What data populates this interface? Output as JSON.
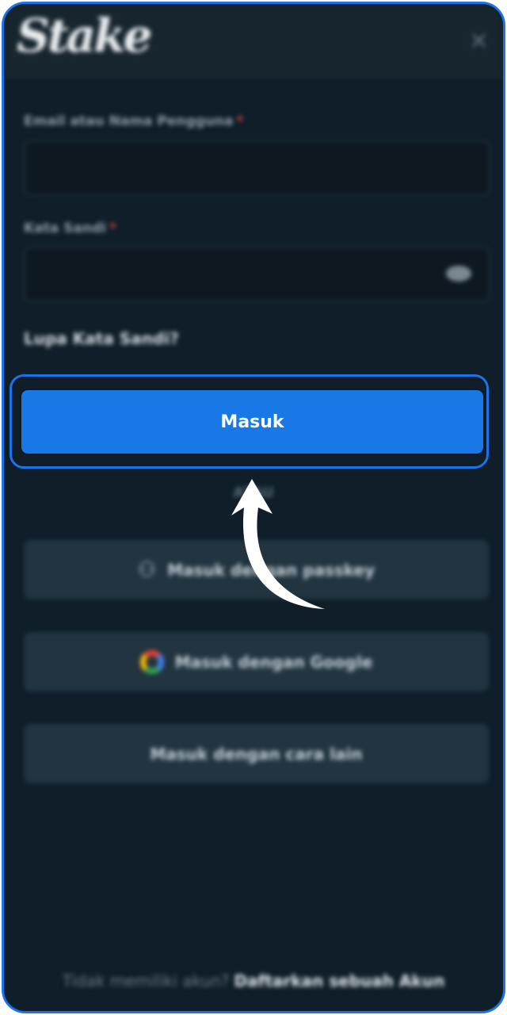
{
  "header": {
    "logo_text": "Stake",
    "close_glyph": "✕"
  },
  "form": {
    "username_label": "Email atau Nama Pengguna",
    "password_label": "Kata Sandi",
    "required_mark": "*",
    "forgot_password": "Lupa Kata Sandi?",
    "submit_label": "Masuk",
    "divider_text": "ATAU"
  },
  "alternatives": {
    "passkey_label": "Masuk dengan passkey",
    "google_label": "Masuk dengan Google",
    "other_label": "Masuk dengan cara lain"
  },
  "footer": {
    "prompt": "Tidak memiliki akun?",
    "register_link": "Daftarkan sebuah Akun"
  },
  "icons": {
    "passkey": "person-key-icon",
    "google": "google-icon",
    "eye": "eye-icon",
    "close": "close-icon",
    "arrow": "curved-arrow-icon"
  },
  "colors": {
    "accent": "#1778e6",
    "background": "#0f1e29",
    "required": "#e0454a"
  }
}
